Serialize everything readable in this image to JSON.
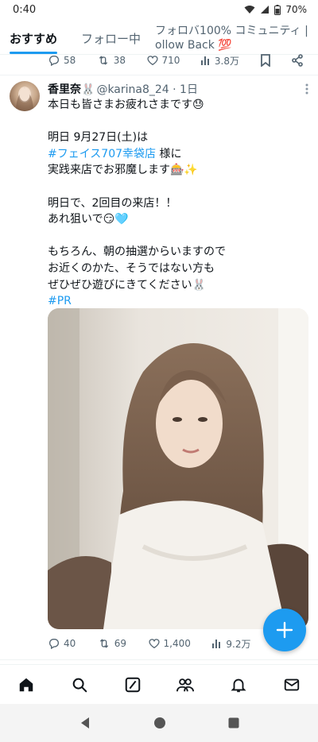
{
  "status_bar": {
    "time": "0:40",
    "battery": "70%"
  },
  "tabs": [
    {
      "label": "おすすめ",
      "active": true
    },
    {
      "label": "フォロー中",
      "active": false
    }
  ],
  "community_tab": {
    "line1": "フォロバ100% コミュニティ |",
    "line2": "ollow Back 💯"
  },
  "prev_tweet": {
    "replies": "58",
    "retweets": "38",
    "likes": "710",
    "views": "3.8万"
  },
  "tweet": {
    "author_name": "香里奈🐰",
    "handle_time": "@karina8_24 · 1日",
    "lines": {
      "l1": "本日も皆さまお疲れさまです😓",
      "l2": "明日 9月27日(土)は",
      "l3_link": "#フェイス707幸袋店",
      "l3_rest": " 様に",
      "l4": "実践来店でお邪魔します🎰✨",
      "l5": "明日で、2回目の来店！！",
      "l6": "あれ狙いで😏🩵",
      "l7": "もちろん、朝の抽選からいますので",
      "l8": "お近くのかた、そうではない方も",
      "l9": "ぜひぜひ遊びにきてください🐰",
      "hashtag": "#PR"
    },
    "stats": {
      "replies": "40",
      "retweets": "69",
      "likes": "1,400",
      "views": "9.2万"
    }
  },
  "colors": {
    "accent": "#1d9bf0",
    "text": "#0f1419",
    "secondary": "#536471"
  }
}
